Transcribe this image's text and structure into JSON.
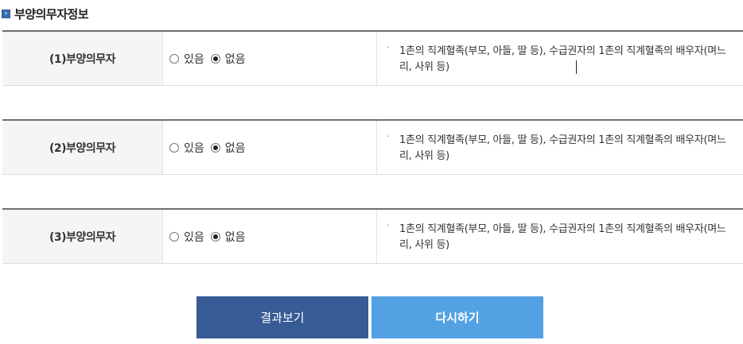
{
  "section": {
    "title": "부양의무자정보",
    "icon": "square-arrow-icon"
  },
  "rows": [
    {
      "label": "(1)부양의무자",
      "options": [
        {
          "label": "있음",
          "checked": false
        },
        {
          "label": "없음",
          "checked": true
        }
      ],
      "bullet": "·",
      "description": "1촌의 직계혈족(부모, 아들, 딸 등), 수급권자의 1촌의 직계혈족의 배우자(며느리, 사위 등)"
    },
    {
      "label": "(2)부양의무자",
      "options": [
        {
          "label": "있음",
          "checked": false
        },
        {
          "label": "없음",
          "checked": true
        }
      ],
      "bullet": "·",
      "description": "1촌의 직계혈족(부모, 아들, 딸 등), 수급권자의 1촌의 직계혈족의 배우자(며느리, 사위 등)"
    },
    {
      "label": "(3)부양의무자",
      "options": [
        {
          "label": "있음",
          "checked": false
        },
        {
          "label": "없음",
          "checked": true
        }
      ],
      "bullet": "·",
      "description": "1촌의 직계혈족(부모, 아들, 딸 등), 수급권자의 1촌의 직계혈족의 배우자(며느리, 사위 등)"
    }
  ],
  "buttons": {
    "result_label": "결과보기",
    "reset_label": "다시하기"
  },
  "colors": {
    "result_button": "#365b95",
    "reset_button": "#53a1e3",
    "header_icon": "#3a6fb5"
  }
}
